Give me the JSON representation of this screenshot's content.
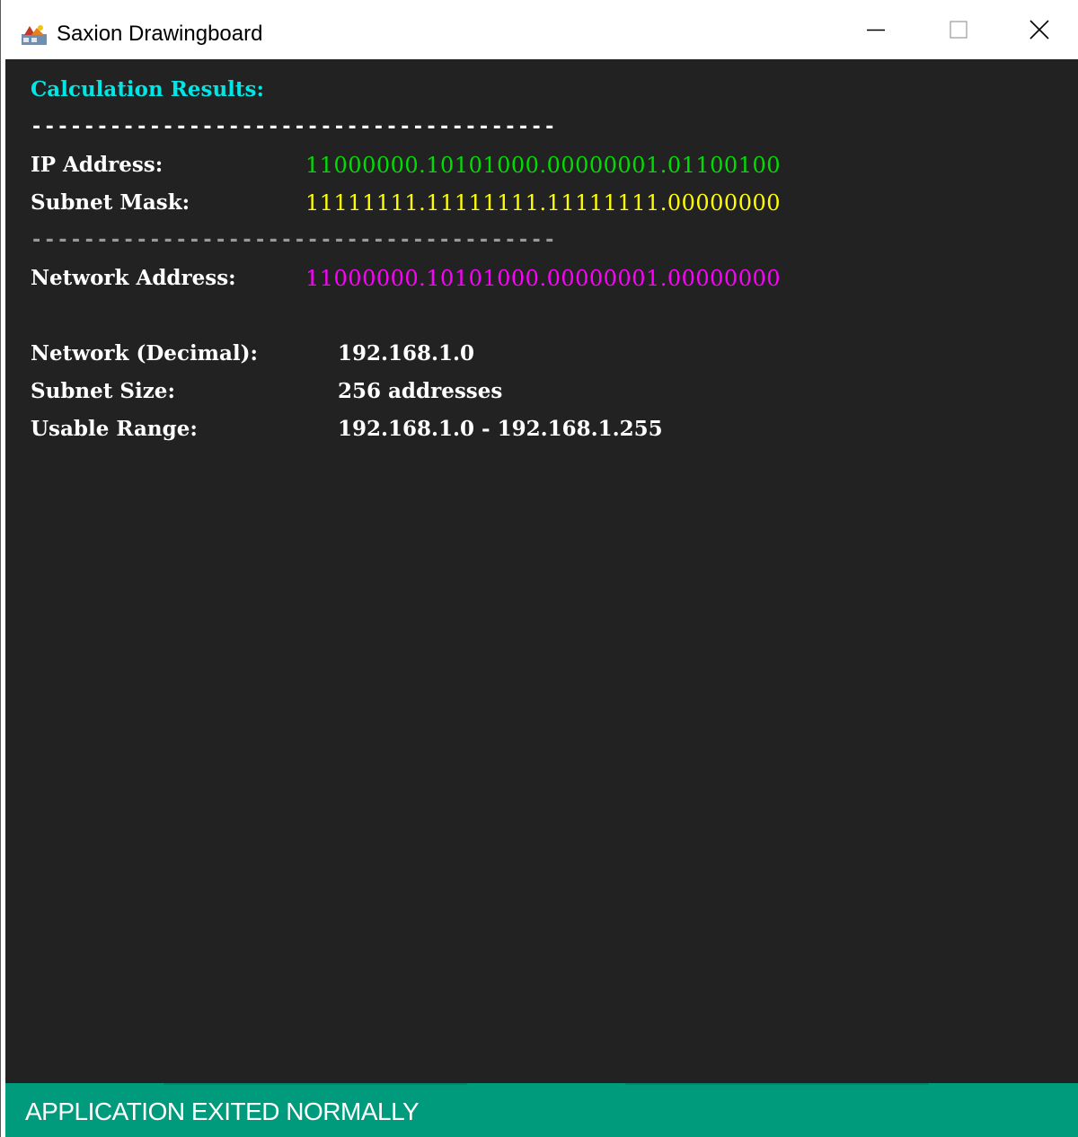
{
  "window": {
    "title": "Saxion Drawingboard",
    "app_icon": "java-cup-icon"
  },
  "titlebar_controls": {
    "minimize_icon": "minimize-icon",
    "maximize_icon": "maximize-icon",
    "close_icon": "close-icon"
  },
  "results": {
    "heading": "Calculation Results:",
    "heading_color": "#00e5e5",
    "separator_top": "----------------------------------------",
    "separator_top_color": "#ffffff",
    "ip_label": "IP Address:",
    "ip_value": "11000000.10101000.00000001.01100100",
    "ip_color": "#00dd00",
    "mask_label": "Subnet Mask:",
    "mask_value": "11111111.11111111.11111111.00000000",
    "mask_color": "#ffff00",
    "separator_mid": "----------------------------------------",
    "separator_mid_color": "#9a9a9a",
    "network_label": "Network Address:",
    "network_value": "11000000.10101000.00000001.00000000",
    "network_color": "#ff00ff",
    "network_decimal_label": "Network (Decimal):",
    "network_decimal_value": "192.168.1.0",
    "subnet_size_label": "Subnet Size:",
    "subnet_size_value": "256 addresses",
    "usable_range_label": "Usable Range:",
    "usable_range_value": "192.168.1.0 - 192.168.1.255"
  },
  "status": {
    "text": "APPLICATION EXITED NORMALLY",
    "background": "#009b7d"
  }
}
